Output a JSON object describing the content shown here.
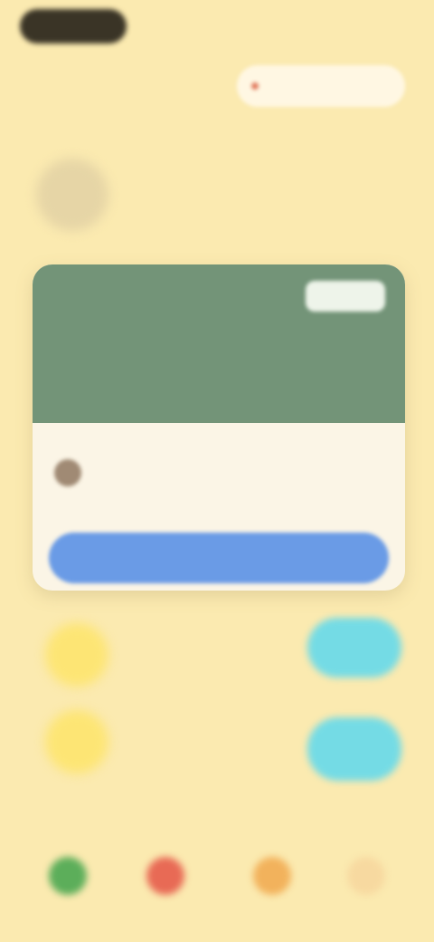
{
  "header": {
    "logo": "",
    "status": "",
    "subtitle": "",
    "invite_label": ""
  },
  "profile": {
    "name": "",
    "meta": ""
  },
  "card": {
    "kicker": "",
    "title": "",
    "badge": "",
    "row_label": "",
    "row_sub": "",
    "cta_label": ""
  },
  "list": [
    {
      "title": "",
      "sub": "",
      "action": ""
    },
    {
      "title": "",
      "sub": "",
      "action": ""
    }
  ],
  "bottom": {
    "section_left": "",
    "section_right": "",
    "nav": [
      {
        "label": "",
        "color": "#5cae5a"
      },
      {
        "label": "",
        "color": "#e86a55"
      },
      {
        "label": "",
        "color": "#f2b25c"
      },
      {
        "label": "",
        "color": "#f7d9a0"
      }
    ]
  },
  "colors": {
    "background": "#fbeab0",
    "card_header": "#739478",
    "cta": "#6a9be6",
    "accent_yellow": "#fde574",
    "accent_cyan": "#74dbe5"
  }
}
